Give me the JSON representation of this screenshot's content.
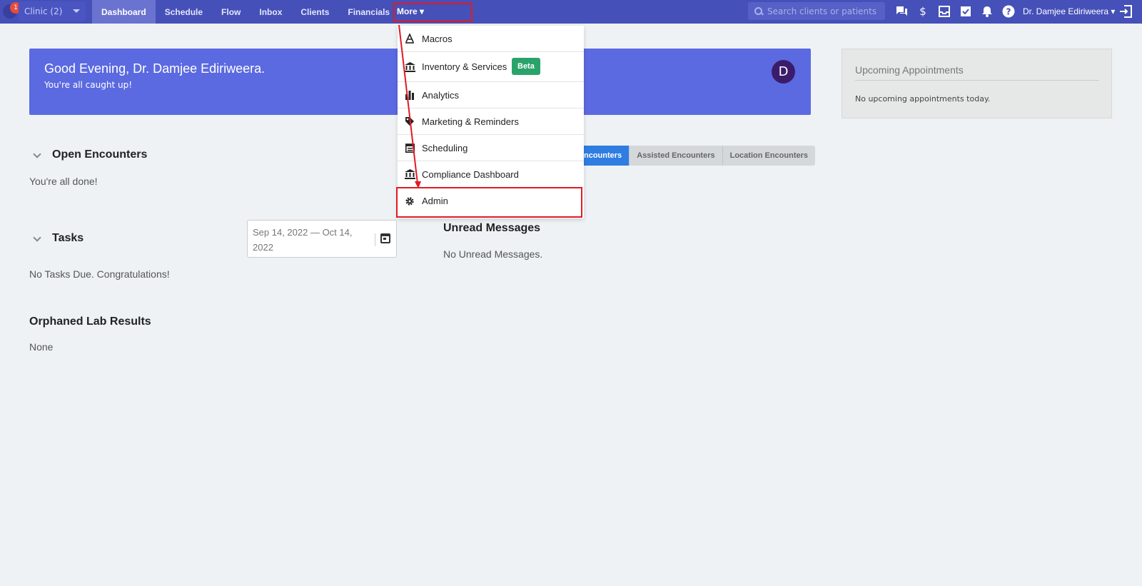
{
  "nav": {
    "notification_count": "1",
    "clinic_label": "Clinic (2)",
    "links": [
      "Dashboard",
      "Schedule",
      "Flow",
      "Inbox",
      "Clients",
      "Financials"
    ],
    "more_label": "More ▾",
    "search_placeholder": "Search clients or patients",
    "user_label": "Dr. Damjee Ediriweera ▾",
    "icons": [
      "chat-icon",
      "dollar-icon",
      "inbox-icon",
      "checkbox-icon",
      "bell-icon",
      "help-icon",
      "logout-icon"
    ]
  },
  "banner": {
    "greeting": "Good Evening, Dr. Damjee Ediriweera.",
    "subtitle": "You're all caught up!",
    "avatar_initial": "D",
    "color": "#5b6ae0"
  },
  "upcoming": {
    "title": "Upcoming Appointments",
    "empty": "No upcoming appointments today."
  },
  "open_encounters": {
    "title": "Open Encounters",
    "empty": "You're all done!",
    "tabs": [
      "ncounters",
      "Assisted Encounters",
      "Location Encounters"
    ]
  },
  "tasks": {
    "title": "Tasks",
    "empty": "No Tasks Due. Congratulations!",
    "date_range": "Sep 14, 2022 — Oct 14, 2022"
  },
  "unread": {
    "title": "Unread Messages",
    "empty": "No Unread Messages."
  },
  "orphaned": {
    "title": "Orphaned Lab Results",
    "empty": "None"
  },
  "dropdown": {
    "items": [
      {
        "label": "Macros",
        "icon": "macros-icon"
      },
      {
        "label": "Inventory & Services",
        "icon": "bank-icon",
        "badge": "Beta"
      },
      {
        "label": "Analytics",
        "icon": "bar-chart-icon"
      },
      {
        "label": "Marketing & Reminders",
        "icon": "tag-icon"
      },
      {
        "label": "Scheduling",
        "icon": "calendar-icon"
      },
      {
        "label": "Compliance Dashboard",
        "icon": "bank-icon"
      },
      {
        "label": "Admin",
        "icon": "gear-icon"
      }
    ]
  },
  "colors": {
    "nav_bg": "#4550b8",
    "highlight_red": "#e01b24",
    "beta_green": "#2aa36a",
    "active_tab_blue": "#2f7de1"
  }
}
